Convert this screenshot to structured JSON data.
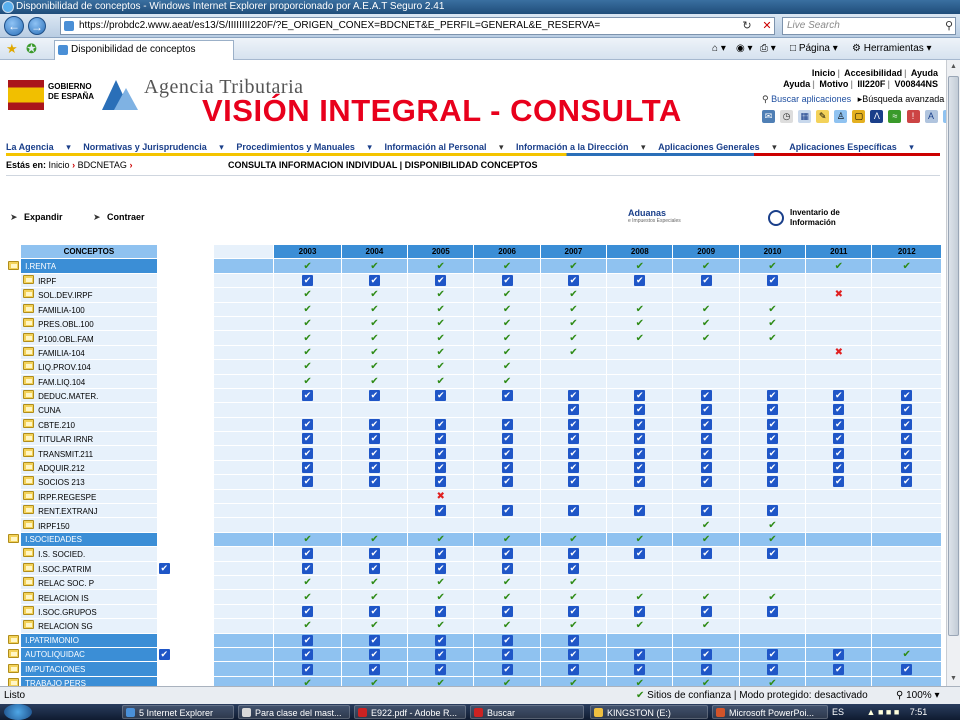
{
  "window": {
    "title": "Disponibilidad de conceptos - Windows Internet Explorer proporcionado por A.E.A.T Seguro 2.41"
  },
  "address": {
    "url": "https://probdc2.www.aeat/es13/S/IIIIIIII220F/?E_ORIGEN_CONEX=BDCNET&E_PERFIL=GENERAL&E_RESERVA=",
    "search_placeholder": "Live Search"
  },
  "tab": {
    "label": "Disponibilidad de conceptos"
  },
  "commands": {
    "page": "Página",
    "tools": "Herramientas"
  },
  "header": {
    "gov_label": "GOBIERNO DE ESPAÑA",
    "agency": "Agencia Tributaria",
    "overlay_title": "VISIÓN INTEGRAL - CONSULTA",
    "links_row1": [
      "Inicio",
      "Accesibilidad",
      "Ayuda"
    ],
    "links_row2": [
      "Ayuda",
      "Motivo",
      "III220F",
      "V00844NS"
    ],
    "search_apps": "Buscar aplicaciones",
    "advanced_search": "Búsqueda avanzada"
  },
  "menu": [
    {
      "label": "La Agencia",
      "bold": true
    },
    {
      "label": "Normativas y Jurisprudencia",
      "bold": true
    },
    {
      "label": "Procedimientos y Manuales",
      "bold": true
    },
    {
      "label": "Información al Personal",
      "bold": false
    },
    {
      "label": "Información a la Dirección",
      "bold": false
    },
    {
      "label": "Aplicaciones Generales",
      "bold": false
    },
    {
      "label": "Aplicaciones Específicas",
      "bold": true
    }
  ],
  "breadcrumb": {
    "prefix": "Estás en:",
    "items": [
      "Inicio",
      "BDCNETAG"
    ],
    "title": "CONSULTA INFORMACION INDIVIDUAL | DISPONIBILIDAD CONCEPTOS"
  },
  "tools": {
    "expand": "Expandir",
    "collapse": "Contraer",
    "aduanas": "Aduanas",
    "aduanas_sub": "e Impuestos Especiales",
    "inventory": "Inventario de Información"
  },
  "grid": {
    "concepts_header": "CONCEPTOS",
    "years": [
      "2003",
      "2004",
      "2005",
      "2006",
      "2007",
      "2008",
      "2009",
      "2010",
      "2011",
      "2012"
    ],
    "rows": [
      {
        "name": "I.RENTA",
        "level": 0,
        "extra": false,
        "marks": [
          "c",
          "c",
          "c",
          "c",
          "c",
          "c",
          "c",
          "c",
          "c",
          "c"
        ]
      },
      {
        "name": "IRPF",
        "level": 1,
        "extra": false,
        "marks": [
          "b",
          "b",
          "b",
          "b",
          "b",
          "b",
          "b",
          "b",
          "",
          ""
        ]
      },
      {
        "name": "SOL.DEV.IRPF",
        "level": 1,
        "extra": false,
        "marks": [
          "c",
          "c",
          "c",
          "c",
          "c",
          "",
          "",
          "",
          "x",
          ""
        ]
      },
      {
        "name": "FAMILIA-100",
        "level": 1,
        "extra": false,
        "marks": [
          "c",
          "c",
          "c",
          "c",
          "c",
          "c",
          "c",
          "c",
          "",
          ""
        ]
      },
      {
        "name": "PRES.OBL.100",
        "level": 1,
        "extra": false,
        "marks": [
          "c",
          "c",
          "c",
          "c",
          "c",
          "c",
          "c",
          "c",
          "",
          ""
        ]
      },
      {
        "name": "P100.OBL.FAM",
        "level": 1,
        "extra": false,
        "marks": [
          "c",
          "c",
          "c",
          "c",
          "c",
          "c",
          "c",
          "c",
          "",
          ""
        ]
      },
      {
        "name": "FAMILIA-104",
        "level": 1,
        "extra": false,
        "marks": [
          "c",
          "c",
          "c",
          "c",
          "c",
          "",
          "",
          "",
          "x",
          ""
        ]
      },
      {
        "name": "LIQ.PROV.104",
        "level": 1,
        "extra": false,
        "marks": [
          "c",
          "c",
          "c",
          "c",
          "",
          "",
          "",
          "",
          "",
          ""
        ]
      },
      {
        "name": "FAM.LIQ.104",
        "level": 1,
        "extra": false,
        "marks": [
          "c",
          "c",
          "c",
          "c",
          "",
          "",
          "",
          "",
          "",
          ""
        ]
      },
      {
        "name": "DEDUC.MATER.",
        "level": 1,
        "extra": false,
        "marks": [
          "b",
          "b",
          "b",
          "b",
          "b",
          "b",
          "b",
          "b",
          "b",
          "b"
        ]
      },
      {
        "name": "CUNA",
        "level": 1,
        "extra": false,
        "marks": [
          "",
          "",
          "",
          "",
          "b",
          "b",
          "b",
          "b",
          "b",
          "b"
        ]
      },
      {
        "name": "CBTE.210",
        "level": 1,
        "extra": false,
        "marks": [
          "b",
          "b",
          "b",
          "b",
          "b",
          "b",
          "b",
          "b",
          "b",
          "b"
        ]
      },
      {
        "name": "TITULAR IRNR",
        "level": 1,
        "extra": false,
        "marks": [
          "b",
          "b",
          "b",
          "b",
          "b",
          "b",
          "b",
          "b",
          "b",
          "b"
        ]
      },
      {
        "name": "TRANSMIT.211",
        "level": 1,
        "extra": false,
        "marks": [
          "b",
          "b",
          "b",
          "b",
          "b",
          "b",
          "b",
          "b",
          "b",
          "b"
        ]
      },
      {
        "name": "ADQUIR.212",
        "level": 1,
        "extra": false,
        "marks": [
          "b",
          "b",
          "b",
          "b",
          "b",
          "b",
          "b",
          "b",
          "b",
          "b"
        ]
      },
      {
        "name": "SOCIOS 213",
        "level": 1,
        "extra": false,
        "marks": [
          "b",
          "b",
          "b",
          "b",
          "b",
          "b",
          "b",
          "b",
          "b",
          "b"
        ]
      },
      {
        "name": "IRPF.REGESPE",
        "level": 1,
        "extra": false,
        "marks": [
          "",
          "",
          "x",
          "",
          "",
          "",
          "",
          "",
          "",
          ""
        ]
      },
      {
        "name": "RENT.EXTRANJ",
        "level": 1,
        "extra": false,
        "marks": [
          "",
          "",
          "b",
          "b",
          "b",
          "b",
          "b",
          "b",
          "",
          ""
        ]
      },
      {
        "name": "IRPF150",
        "level": 1,
        "extra": false,
        "marks": [
          "",
          "",
          "",
          "",
          "",
          "",
          "c",
          "c",
          "",
          ""
        ]
      },
      {
        "name": "I.SOCIEDADES",
        "level": 0,
        "extra": false,
        "marks": [
          "c",
          "c",
          "c",
          "c",
          "c",
          "c",
          "c",
          "c",
          "",
          ""
        ]
      },
      {
        "name": "I.S. SOCIED.",
        "level": 1,
        "extra": false,
        "marks": [
          "b",
          "b",
          "b",
          "b",
          "b",
          "b",
          "b",
          "b",
          "",
          ""
        ]
      },
      {
        "name": "I.SOC.PATRIM",
        "level": 1,
        "extra": true,
        "marks": [
          "b",
          "b",
          "b",
          "b",
          "b",
          "",
          "",
          "",
          "",
          ""
        ]
      },
      {
        "name": "RELAC SOC. P",
        "level": 1,
        "extra": false,
        "marks": [
          "c",
          "c",
          "c",
          "c",
          "c",
          "",
          "",
          "",
          "",
          ""
        ]
      },
      {
        "name": "RELACION IS",
        "level": 1,
        "extra": false,
        "marks": [
          "c",
          "c",
          "c",
          "c",
          "c",
          "c",
          "c",
          "c",
          "",
          ""
        ]
      },
      {
        "name": "I.SOC.GRUPOS",
        "level": 1,
        "extra": false,
        "marks": [
          "b",
          "b",
          "b",
          "b",
          "b",
          "b",
          "b",
          "b",
          "",
          ""
        ]
      },
      {
        "name": "RELACION SG",
        "level": 1,
        "extra": false,
        "marks": [
          "c",
          "c",
          "c",
          "c",
          "c",
          "c",
          "c",
          "",
          "",
          ""
        ]
      },
      {
        "name": "I.PATRIMONIO",
        "level": 0,
        "extra": false,
        "marks": [
          "b",
          "b",
          "b",
          "b",
          "b",
          "",
          "",
          "",
          "",
          ""
        ]
      },
      {
        "name": "AUTOLIQUIDAC",
        "level": 0,
        "extra": true,
        "marks": [
          "b",
          "b",
          "b",
          "b",
          "b",
          "b",
          "b",
          "b",
          "b",
          "c"
        ]
      },
      {
        "name": "IMPUTACIONES",
        "level": 0,
        "extra": false,
        "marks": [
          "b",
          "b",
          "b",
          "b",
          "b",
          "b",
          "b",
          "b",
          "b",
          "b"
        ]
      },
      {
        "name": "TRABAJO PERS",
        "level": 0,
        "extra": false,
        "marks": [
          "c",
          "c",
          "c",
          "c",
          "c",
          "c",
          "c",
          "c",
          "",
          ""
        ]
      }
    ]
  },
  "status": {
    "left": "Listo",
    "zone": "Sitios de confianza | Modo protegido: desactivado",
    "zoom": "100%"
  },
  "taskbar": {
    "items": [
      {
        "label": "5 Internet Explorer",
        "color": "#4a90d9"
      },
      {
        "label": "Para clase del mast...",
        "color": "#d8d8d8"
      },
      {
        "label": "E922.pdf - Adobe R...",
        "color": "#c22"
      },
      {
        "label": "Buscar",
        "color": "#c22"
      },
      {
        "label": "KINGSTON (E:)",
        "color": "#f0c040"
      },
      {
        "label": "Microsoft PowerPoi...",
        "color": "#d2542a"
      }
    ],
    "lang": "ES",
    "clock": "7:51"
  },
  "colors": {
    "accent": "#3b8ed6",
    "title_red": "#e8001c",
    "check": "#2e8b16",
    "box": "#1f56c7",
    "cross": "#e02020"
  }
}
